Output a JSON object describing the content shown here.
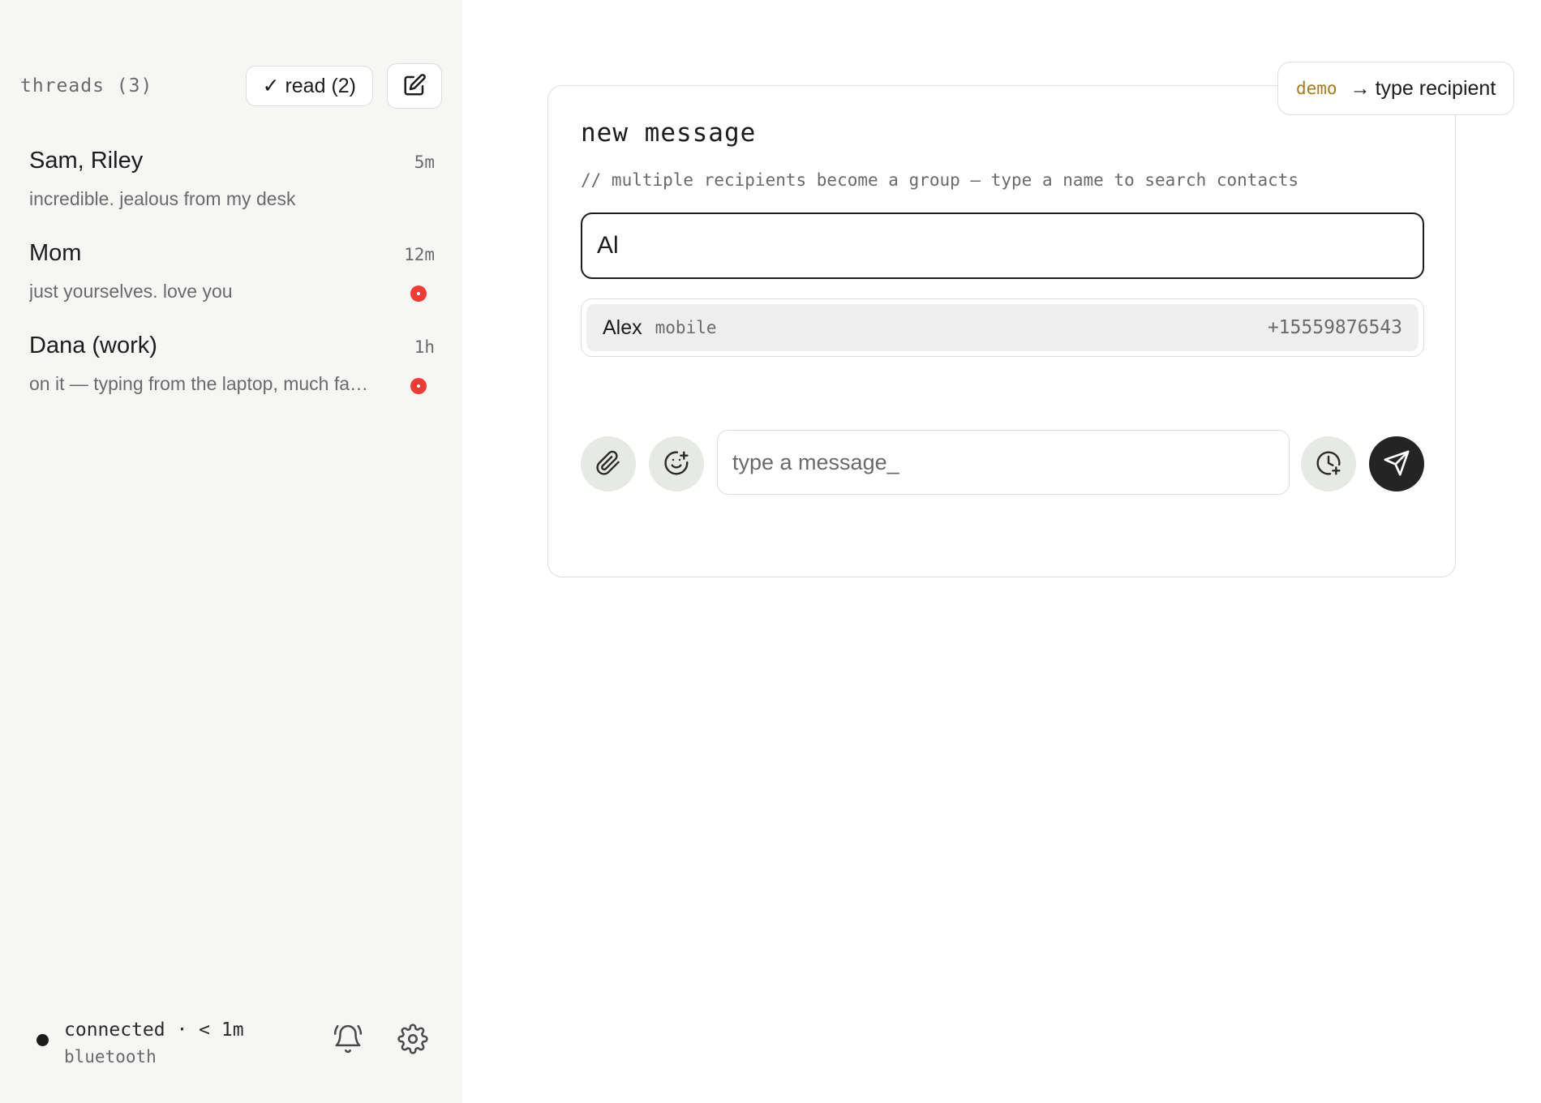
{
  "sidebar": {
    "title": "threads (3)",
    "read_button": "✓ read (2)",
    "threads": [
      {
        "name": "Sam, Riley",
        "time": "5m",
        "preview": "incredible. jealous from my desk",
        "unread": false
      },
      {
        "name": "Mom",
        "time": "12m",
        "preview": "just yourselves. love you",
        "unread": true
      },
      {
        "name": "Dana (work)",
        "time": "1h",
        "preview": "on it — typing from the laptop, much fast...",
        "unread": true
      }
    ],
    "footer": {
      "status": "connected · < 1m",
      "connection_type": "bluetooth"
    }
  },
  "demo": {
    "tag": "demo",
    "arrow": "→",
    "text": "type recipient"
  },
  "composer": {
    "title": "new message",
    "subtitle": "// multiple recipients become a group — type a name to search contacts",
    "recipient_value": "Al",
    "suggestion": {
      "name": "Alex",
      "type": "mobile",
      "number": "+15559876543"
    },
    "message_placeholder": "type a message_"
  },
  "icons": {
    "compose": "compose-icon",
    "bell": "bell-icon",
    "gear": "gear-icon",
    "attach": "paperclip-icon",
    "emoji": "emoji-add-icon",
    "schedule": "clock-plus-icon",
    "send": "send-icon"
  },
  "colors": {
    "sidebar_bg": "#f6f7f5",
    "unread": "#ef3b34",
    "demo_tag": "#a77a1a",
    "send_bg": "#242424",
    "round_btn_bg": "#e6e9e4"
  }
}
